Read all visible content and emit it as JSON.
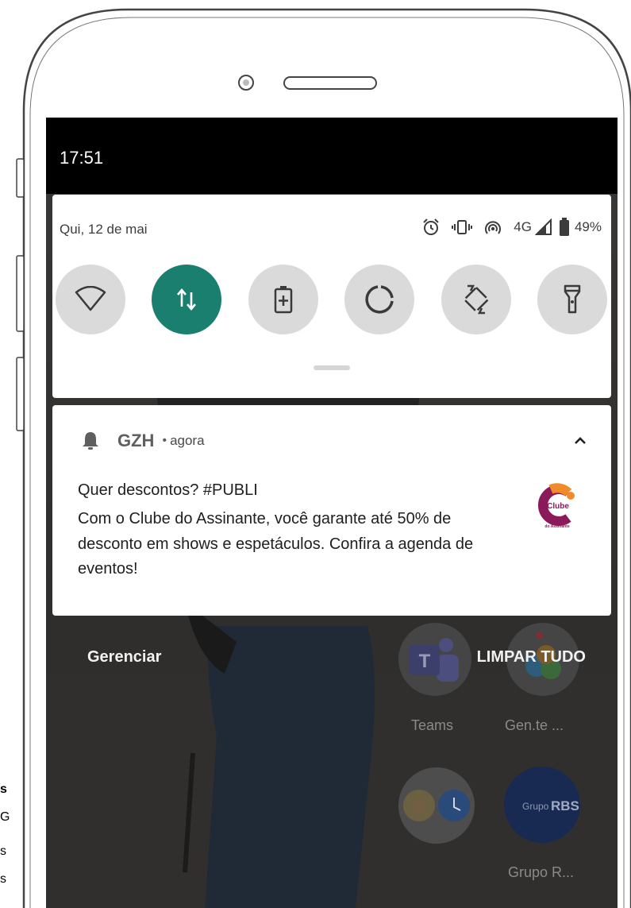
{
  "status_bar": {
    "time": "17:51"
  },
  "quick_settings": {
    "date": "Qui, 12 de mai",
    "network": "4G",
    "battery": "49%",
    "tiles": [
      {
        "name": "wifi-icon",
        "active": false
      },
      {
        "name": "mobile-data-icon",
        "active": true
      },
      {
        "name": "battery-saver-icon",
        "active": false
      },
      {
        "name": "data-saver-icon",
        "active": false
      },
      {
        "name": "auto-rotate-icon",
        "active": false
      },
      {
        "name": "flashlight-icon",
        "active": false
      }
    ]
  },
  "notification": {
    "app": "GZH",
    "separator": "•",
    "time": "agora",
    "title": "Quer descontos? #PUBLI",
    "body": "Com o Clube do Assinante, você garante até 50% de desconto em shows e espetáculos. Confira a agenda de eventos!",
    "logo_text": "Clube",
    "logo_subtext": "do Assinante"
  },
  "actions": {
    "manage": "Gerenciar",
    "clear_all": "LIMPAR TUDO"
  },
  "home_apps": {
    "teams": "Teams",
    "gente": "Gen.te ...",
    "grupo_rbs": "Grupo R...",
    "rbs_logo_prefix": "Grupo",
    "rbs_logo_main": "RBS",
    "teams_letter": "T",
    "google_letter": "G"
  },
  "side_fragment": [
    "s",
    "G",
    "s",
    "s"
  ],
  "colors": {
    "accent": "#1a7f6e",
    "tile_inactive": "#dadada",
    "status_bar": "#000000"
  }
}
